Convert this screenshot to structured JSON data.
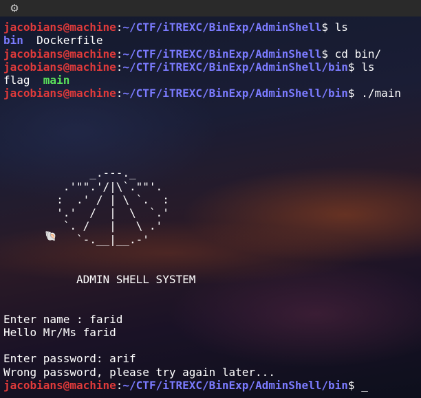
{
  "titlebar": {
    "icon": "gear-icon"
  },
  "prompt": {
    "user": "jacobians@machine",
    "colon": ":",
    "path_root": "~/CTF/iTREXC/BinExp/AdminShell",
    "path_bin": "~/CTF/iTREXC/BinExp/AdminShell/bin",
    "dollar": "$"
  },
  "commands": {
    "c1": " ls",
    "c2": " cd bin/",
    "c3": " ls",
    "c4": " ./main"
  },
  "ls1": {
    "dir": "bin",
    "file": "Dockerfile"
  },
  "ls2": {
    "file": "flag",
    "exe": "main"
  },
  "art": [
    "             _.---._",
    "         .'\"\".'/|\\`.\"\"'.",
    "        :  .' / | \\ `.  :",
    "        '.'  /  |  \\  `.'",
    "         `. /   |   \\ .'",
    "           `-.__|__.-'"
  ],
  "system_title": "           ADMIN SHELL SYSTEM",
  "session": {
    "name_prompt": "Enter name : farid",
    "hello": "Hello Mr/Ms farid",
    "password_prompt": "Enter password: arif",
    "error": "Wrong password, please try again later..."
  },
  "cursor": "_",
  "decor_icon": "shell-icon"
}
